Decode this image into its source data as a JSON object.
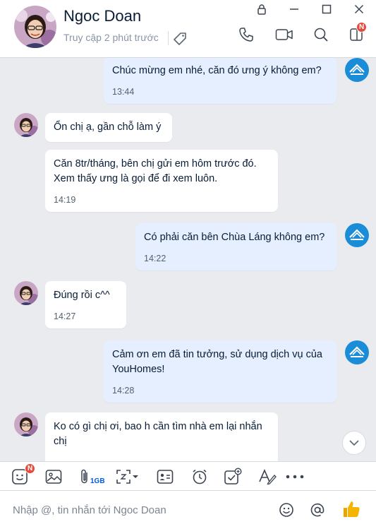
{
  "header": {
    "name": "Ngoc Doan",
    "status": "Truy cập 2 phút trước",
    "notification_badge": "N"
  },
  "messages": [
    {
      "direction": "out",
      "text": "Chúc mừng em nhé, căn đó ưng ý không em?",
      "time": "13:44"
    },
    {
      "direction": "in",
      "text": "Ổn chị ạ, gần chỗ làm ý",
      "time": ""
    },
    {
      "direction": "in",
      "text": "Căn 8tr/tháng, bên chị gửi em hôm trước đó. Xem thấy ưng là gọi để đi xem luôn.",
      "time": "14:19"
    },
    {
      "direction": "out",
      "text": "Có phải căn bên Chùa Láng không em?",
      "time": "14:22"
    },
    {
      "direction": "in",
      "text": "Đúng rồi c^^",
      "time": "14:27"
    },
    {
      "direction": "out",
      "text": "Cảm ơn em đã tin tưởng, sử dụng dịch vụ của YouHomes!",
      "time": "14:28"
    },
    {
      "direction": "in",
      "text": "Ko có gì chị ơi, bao h cần tìm nhà em lại nhắn chị",
      "time": ""
    }
  ],
  "brand": {
    "logo_text": "YouHomes",
    "logo_color": "#1a8cd8"
  },
  "toolbar": {
    "sticker_badge": "N",
    "file_size_label": "1GB"
  },
  "composer": {
    "placeholder": "Nhập @, tin nhắn tới Ngoc Doan"
  },
  "colors": {
    "outgoing_bubble": "#e5efff",
    "incoming_bubble": "#ffffff",
    "chat_background": "#e9ebee",
    "accent": "#005ae0",
    "badge": "#e54b3c",
    "like": "#f5b400"
  }
}
